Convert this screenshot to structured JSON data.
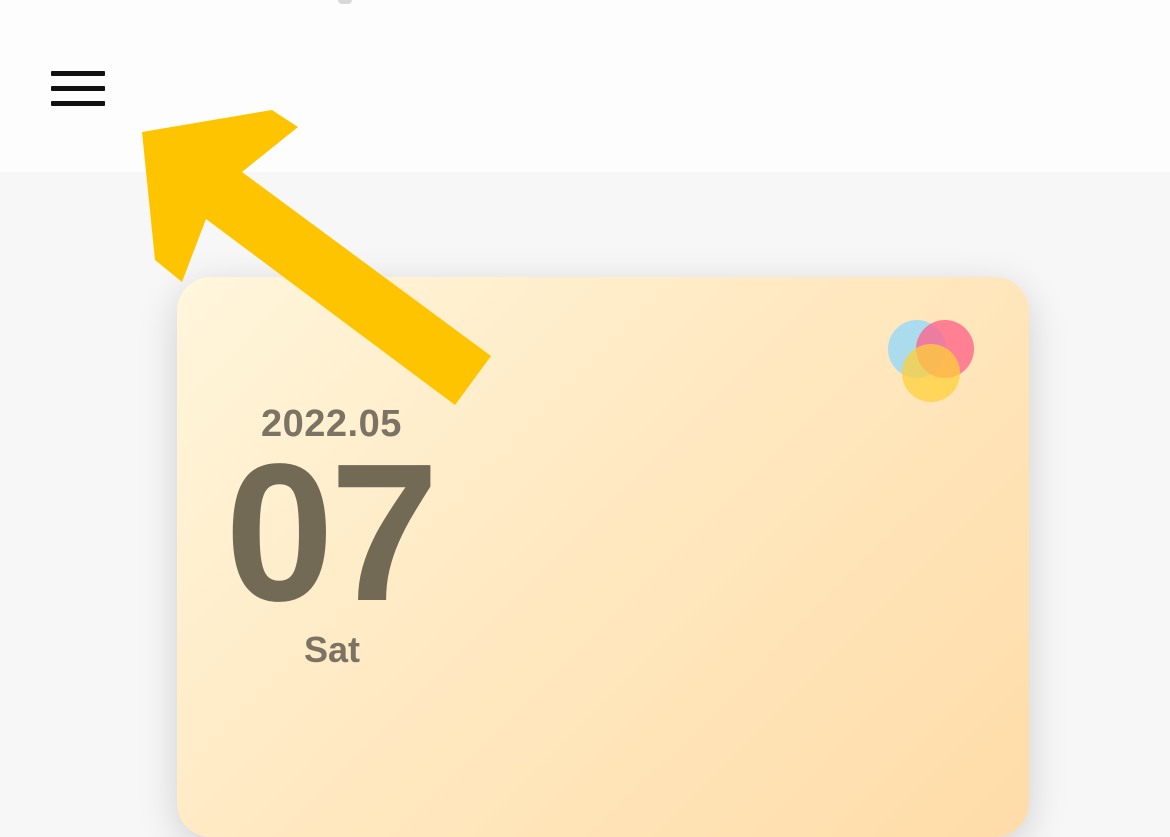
{
  "header": {
    "menu_icon": "hamburger-menu-icon"
  },
  "date_card": {
    "month": "2022.05",
    "day": "07",
    "weekday": "Sat",
    "logo_icon": "venn-circles-logo-icon",
    "gradient_colors": [
      "#fff6dc",
      "#ffe9c2",
      "#ffdca8"
    ],
    "text_color": "#736a56"
  },
  "annotation": {
    "arrow_icon": "pointer-arrow-icon",
    "arrow_color": "#ffc400"
  }
}
